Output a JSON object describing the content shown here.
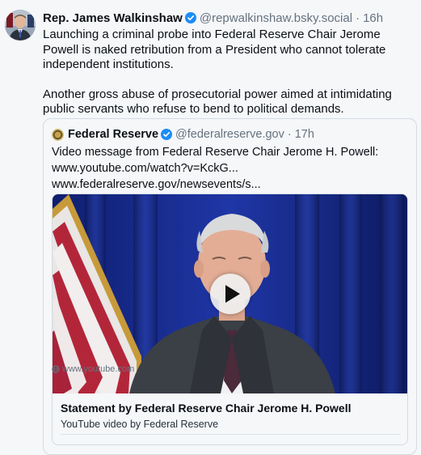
{
  "post": {
    "author_name": "Rep. James Walkinshaw",
    "handle": "@repwalkinshaw.bsky.social",
    "separator": "·",
    "time": "16h",
    "paragraph_1": "Launching a criminal probe into Federal Reserve Chair Jerome Powell is naked retribution from a President who cannot tolerate independent institutions.",
    "paragraph_2": "Another gross abuse of prosecutorial power aimed at intimidating public servants who refuse to bend to political demands."
  },
  "quote": {
    "author_name": "Federal Reserve",
    "handle": "@federalreserve.gov",
    "separator": "·",
    "time": "17h",
    "line_1": "Video message from Federal Reserve Chair Jerome H. Powell:",
    "line_2": "www.youtube.com/watch?v=KckG...",
    "line_3": "www.federalreserve.gov/newsevents/s..."
  },
  "embed": {
    "title": "Statement by Federal Reserve Chair Jerome H. Powell",
    "description": "YouTube video by Federal Reserve",
    "domain": "www.youtube.com",
    "play_icon": "play-icon",
    "domain_icon": "globe-icon"
  },
  "colors": {
    "verified_badge": "#1d8cf8",
    "muted_text": "#66727f",
    "background": "#f5f7f9"
  }
}
